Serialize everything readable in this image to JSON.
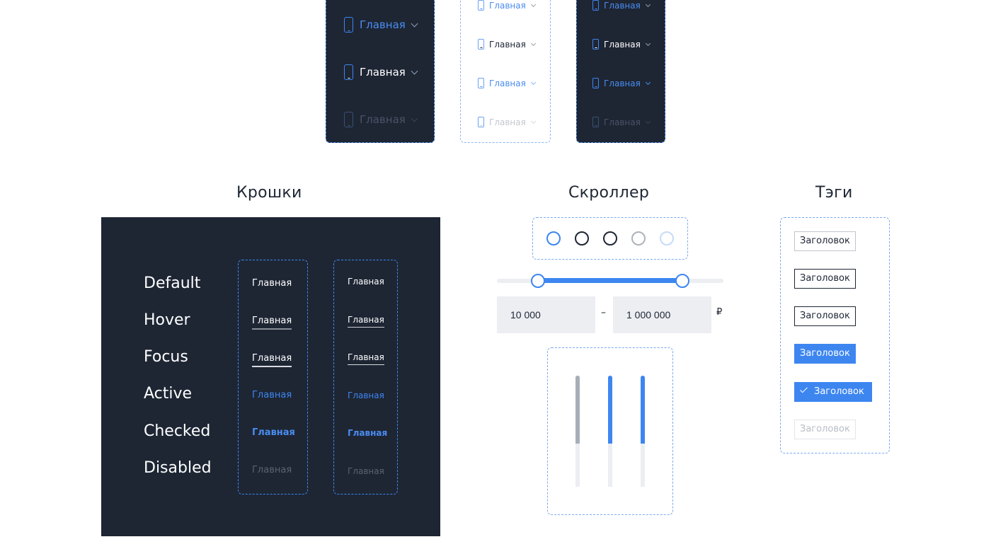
{
  "menu_items": {
    "label": "Главная",
    "panel_large_dark": [
      {
        "state": "active",
        "label": "Главная"
      },
      {
        "state": "default",
        "label": "Главная"
      },
      {
        "state": "disabled",
        "label": "Главная"
      }
    ],
    "panel_small_light": [
      {
        "state": "active",
        "label": "Главная"
      },
      {
        "state": "default",
        "label": "Главная"
      },
      {
        "state": "checked",
        "label": "Главная"
      },
      {
        "state": "disabled",
        "label": "Главная"
      }
    ],
    "panel_small_dark": [
      {
        "state": "active",
        "label": "Главная"
      },
      {
        "state": "default",
        "label": "Главная"
      },
      {
        "state": "checked",
        "label": "Главная"
      },
      {
        "state": "disabled",
        "label": "Главная"
      }
    ]
  },
  "sections": {
    "breadcrumbs_title": "Крошки",
    "scroller_title": "Скроллер",
    "tags_title": "Тэги"
  },
  "breadcrumbs": {
    "states": [
      "Default",
      "Hover",
      "Focus",
      "Active",
      "Checked",
      "Disabled"
    ],
    "column_large": [
      "Главная",
      "Главная",
      "Главная",
      "Главная",
      "Главная",
      "Главная"
    ],
    "column_small": [
      "Главная",
      "Главная",
      "Главная",
      "Главная",
      "Главная",
      "Главная"
    ]
  },
  "scroller": {
    "dots": [
      "active",
      "hover",
      "focus",
      "default",
      "disabled"
    ],
    "range": {
      "min_value": "10 000",
      "max_value": "1 000 000",
      "separator": "–",
      "currency": "₽",
      "low_fraction": 0.18,
      "high_fraction": 0.82
    },
    "vertical_bars": [
      {
        "state": "default",
        "fill_fraction": 0.61
      },
      {
        "state": "hover",
        "fill_fraction": 0.61
      },
      {
        "state": "active",
        "fill_fraction": 0.61
      }
    ]
  },
  "tags": [
    {
      "state": "default",
      "label": "Заголовок"
    },
    {
      "state": "hover",
      "label": "Заголовок"
    },
    {
      "state": "focus",
      "label": "Заголовок"
    },
    {
      "state": "active",
      "label": "Заголовок"
    },
    {
      "state": "checked",
      "label": "Заголовок"
    },
    {
      "state": "disabled",
      "label": "Заголовок"
    }
  ],
  "colors": {
    "accent": "#3d86f0",
    "dark_bg": "#1e2634",
    "input_bg": "#eceef2"
  }
}
